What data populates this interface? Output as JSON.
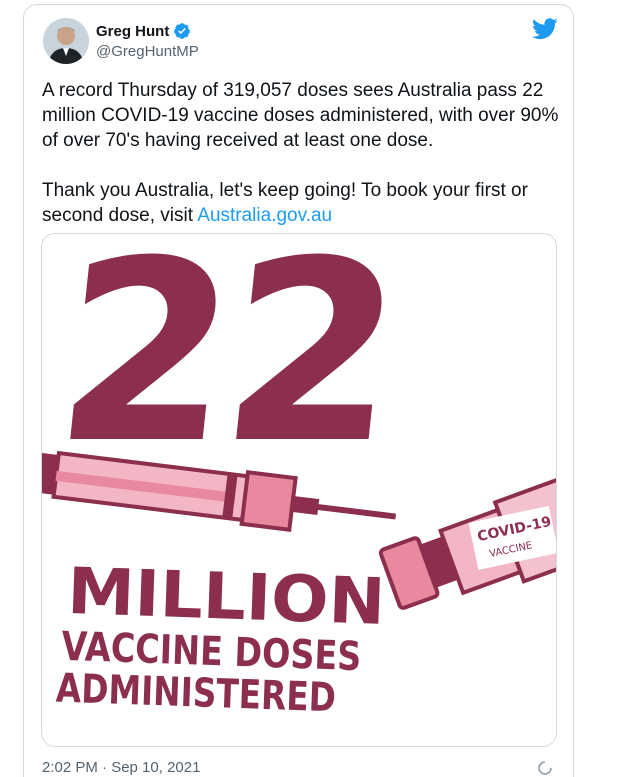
{
  "author": {
    "name": "Greg Hunt",
    "handle": "@GregHuntMP"
  },
  "tweet": {
    "paragraph1": "A record Thursday of 319,057 doses sees Australia pass 22 million COVID-19 vaccine doses administered, with over 90% of over 70's having received at least one dose.",
    "paragraph2_prefix": "Thank you Australia, let's keep going! To book your first or second dose, visit ",
    "link_text": "Australia.gov.au"
  },
  "media": {
    "big_number": "22",
    "line1": "MILLION",
    "line2": "VACCINE DOSES",
    "line3": "ADMINISTERED",
    "vial_label_title": "COVID-19",
    "vial_label_subtitle": "VACCINE"
  },
  "footer": {
    "timestamp": "2:02 PM · Sep 10, 2021"
  },
  "colors": {
    "brand_dark": "#8b2f4c",
    "brand_light": "#e8899f",
    "link": "#1d9bf0"
  },
  "icons": [
    "verified-badge-icon",
    "twitter-bird-icon",
    "loading-icon"
  ]
}
